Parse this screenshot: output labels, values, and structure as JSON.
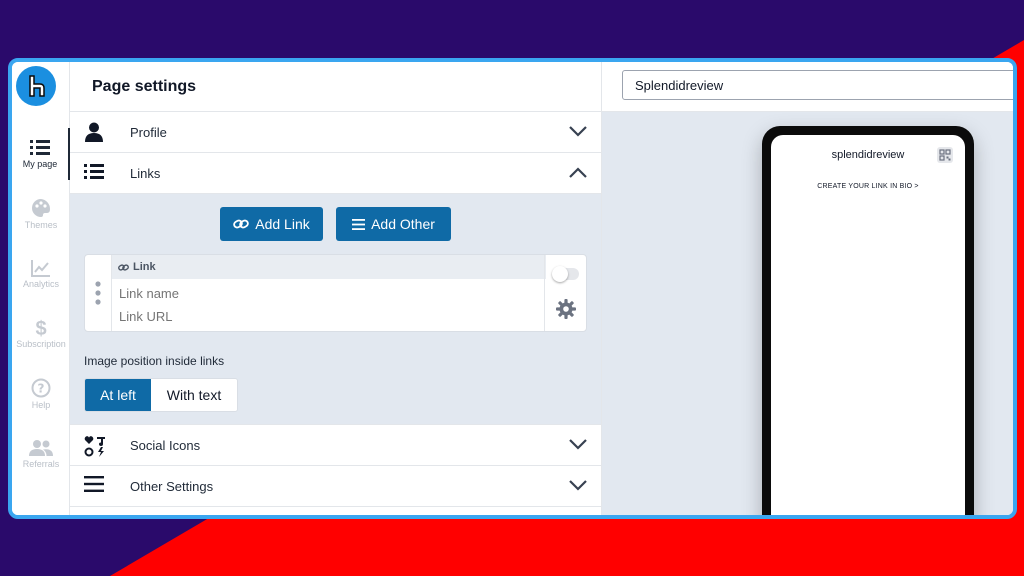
{
  "panel": {
    "title": "Page settings"
  },
  "rail": {
    "items": [
      {
        "label": "My page",
        "icon": "list-icon",
        "active": true
      },
      {
        "label": "Themes",
        "icon": "palette-icon",
        "active": false
      },
      {
        "label": "Analytics",
        "icon": "chart-line-icon",
        "active": false
      },
      {
        "label": "Subscription",
        "icon": "dollar-icon",
        "active": false
      },
      {
        "label": "Help",
        "icon": "help-icon",
        "active": false
      },
      {
        "label": "Referrals",
        "icon": "users-icon",
        "active": false
      }
    ]
  },
  "sections": {
    "profile": "Profile",
    "links": "Links",
    "social": "Social Icons",
    "other": "Other Settings"
  },
  "links": {
    "add_link": "Add Link",
    "add_other": "Add Other",
    "card_title": "Link",
    "name_placeholder": "Link name",
    "url_placeholder": "Link URL",
    "image_position_label": "Image position inside links",
    "positions": [
      "At left",
      "With text"
    ],
    "selected_position": "At left"
  },
  "preview": {
    "page_name": "Splendidreview",
    "phone_title": "splendidreview",
    "phone_cta": "CREATE YOUR LINK IN BIO >"
  },
  "colors": {
    "brand_blue": "#0f6aa6",
    "frame_border": "#3aa6f0",
    "background_purple": "#2a0a6b",
    "background_red": "#ff0000"
  }
}
